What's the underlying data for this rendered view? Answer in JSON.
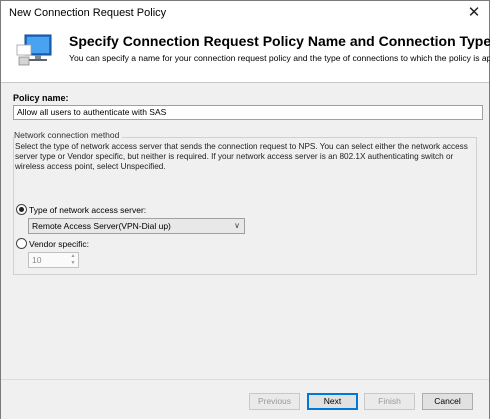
{
  "window": {
    "title": "New Connection Request Policy",
    "close_glyph": "✕"
  },
  "header": {
    "title": "Specify Connection Request Policy Name and Connection Type",
    "subtitle": "You can specify a name for your connection request policy and the type of connections to which the policy is applied",
    "icon": "computer-monitor-icon"
  },
  "policy_name": {
    "label": "Policy name:",
    "value": "Allow all users to authenticate with SAS"
  },
  "network_method": {
    "group_label": "Network connection method",
    "description": "Select the type of network access server that sends the connection request to NPS. You can select either the network access server type or Vendor specific, but neither is required.  If your network access server is an 802.1X authenticating switch or wireless access point, select Unspecified.",
    "type_radio_label": "Type of network access server:",
    "type_selected": true,
    "type_value": "Remote Access Server(VPN-Dial up)",
    "vendor_radio_label": "Vendor specific:",
    "vendor_selected": false,
    "vendor_value": "10"
  },
  "buttons": {
    "previous": "Previous",
    "next": "Next",
    "finish": "Finish",
    "cancel": "Cancel"
  },
  "colors": {
    "accent": "#0078d7",
    "dialog_bg": "#f0f0f0"
  }
}
